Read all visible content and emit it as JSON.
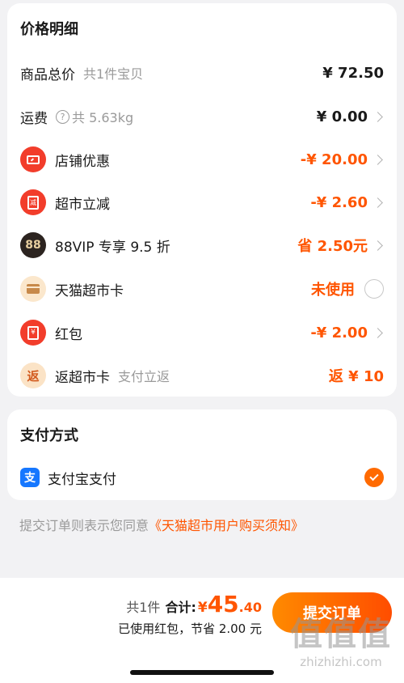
{
  "price_detail": {
    "title": "价格明细",
    "goods_total": {
      "label": "商品总价",
      "sub": "共1件宝贝",
      "value": "¥ 72.50"
    },
    "shipping": {
      "label": "运费",
      "help_glyph": "?",
      "sub": "共 5.63kg",
      "value": "¥ 0.00"
    },
    "store_discount": {
      "label": "店铺优惠",
      "value": "-¥ 20.00"
    },
    "market_cut": {
      "label": "超市立减",
      "icon_text": "减",
      "value": "-¥ 2.60"
    },
    "vip": {
      "label": "88VIP 专享 9.5 折",
      "icon_text": "88",
      "value": "省 2.50元"
    },
    "tmall_card": {
      "label": "天猫超市卡",
      "value": "未使用"
    },
    "red_packet": {
      "label": "红包",
      "value": "-¥ 2.00"
    },
    "rebate_card": {
      "label": "返超市卡",
      "icon_text": "返",
      "sub": "支付立返",
      "value": "返 ¥ 10"
    }
  },
  "payment": {
    "title": "支付方式",
    "method": {
      "label": "支付宝支付",
      "icon_text": "支"
    }
  },
  "agreement": {
    "prefix": "提交订单则表示您同意",
    "link": "《天猫超市用户购买须知》"
  },
  "bottom": {
    "count": "共1件",
    "total_label": "合计:",
    "currency": "¥",
    "total_int": "45",
    "total_dec": ".40",
    "saving_note": "已使用红包，节省 2.00 元",
    "submit_label": "提交订单"
  },
  "watermark": {
    "big": "值值值",
    "small": "zhizhizhi.com"
  },
  "colors": {
    "accent": "#ff5500",
    "alipay": "#1677ff",
    "icon_red": "#f23d2b"
  }
}
